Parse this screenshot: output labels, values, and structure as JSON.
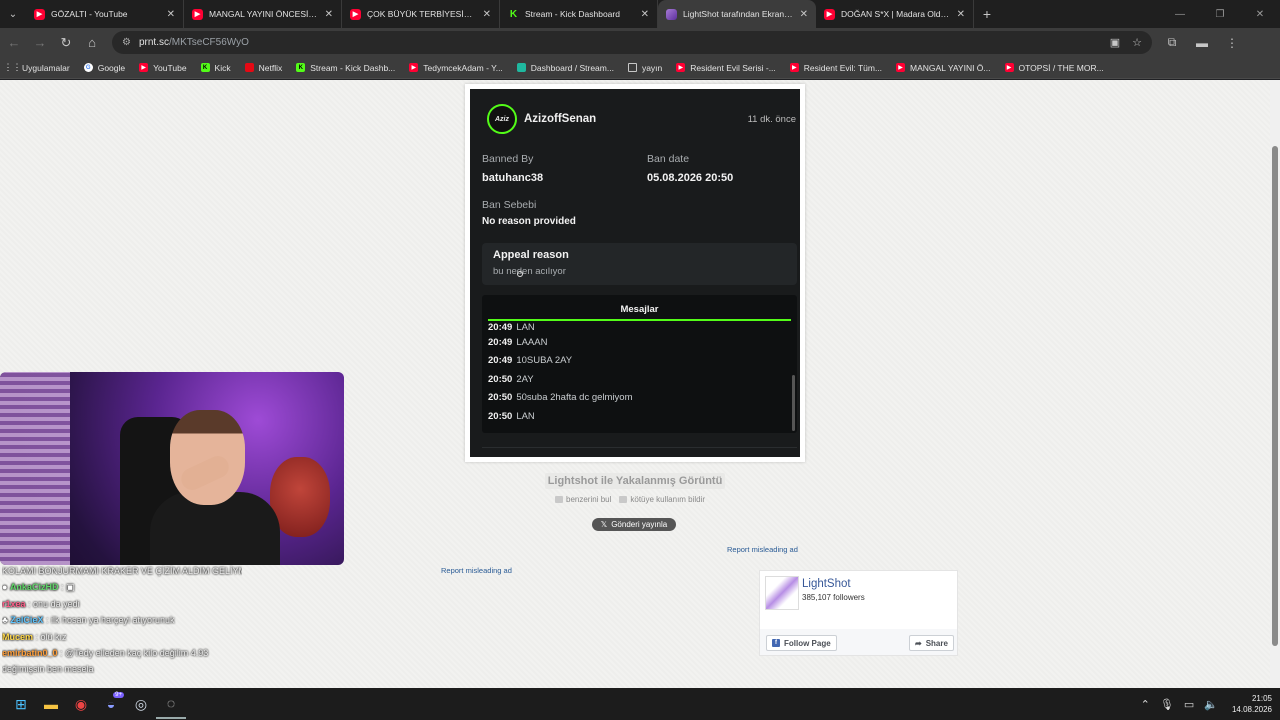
{
  "tabs": [
    {
      "label": "GÖZALTI - YouTube",
      "icon": "youtube-icon"
    },
    {
      "label": "MANGAL YAYINI ÖNCESİ MEKİ",
      "icon": "youtube-icon"
    },
    {
      "label": "ÇOK BÜYÜK TERBİYESİZLİK BEN",
      "icon": "youtube-icon"
    },
    {
      "label": "Stream - Kick Dashboard",
      "icon": "kick-icon"
    },
    {
      "label": "LightShot tarafından Ekran Gör",
      "icon": "lightshot-icon",
      "active": true
    },
    {
      "label": "DOĞAN S*X | Madara Olduk #",
      "icon": "youtube-icon"
    }
  ],
  "address": {
    "host": "prnt.sc",
    "path": "/MKTseCF56WyO"
  },
  "bookmarks": [
    {
      "label": "Uygulamalar",
      "icon": "grid"
    },
    {
      "label": "Google",
      "icon": "g"
    },
    {
      "label": "YouTube",
      "icon": "yt"
    },
    {
      "label": "Kick",
      "icon": "kick"
    },
    {
      "label": "Netflix",
      "icon": "nf"
    },
    {
      "label": "Stream - Kick Dashb...",
      "icon": "kick"
    },
    {
      "label": "TedymcekAdam - Y...",
      "icon": "yt"
    },
    {
      "label": "Dashboard / Stream...",
      "icon": "dash"
    },
    {
      "label": "yayın",
      "icon": "folder"
    },
    {
      "label": "Resident Evil Serisi -...",
      "icon": "yt"
    },
    {
      "label": "Resident Evil: Tüm...",
      "icon": "yt"
    },
    {
      "label": "MANGAL YAYINI Ö...",
      "icon": "yt"
    },
    {
      "label": "OTOPSİ / THE MOR...",
      "icon": "yt"
    }
  ],
  "screenshot": {
    "avatar_text": "Aziz",
    "username": "AzizoffSenan",
    "time_ago": "11 dk. önce",
    "banned_by_label": "Banned By",
    "banned_by": "batuhanc38",
    "ban_date_label": "Ban date",
    "ban_date": "05.08.2026 20:50",
    "reason_label": "Ban Sebebi",
    "reason": "No reason provided",
    "appeal_title": "Appeal reason",
    "appeal_text": "bu neden acılıyor",
    "messages_tab": "Mesajlar",
    "messages": [
      {
        "time": "20:49",
        "text": "LAN"
      },
      {
        "time": "20:49",
        "text": "LAAAN"
      },
      {
        "time": "20:49",
        "text": "10SUBA 2AY"
      },
      {
        "time": "20:50",
        "text": "2AY"
      },
      {
        "time": "20:50",
        "text": "50suba 2hafta dc gelmiyom"
      },
      {
        "time": "20:50",
        "text": "LAN"
      }
    ]
  },
  "lightshot": {
    "caption": "Lightshot ile Yakalanmış Görüntü",
    "find_similar": "benzerini bul",
    "report_abuse": "kötüye kullanım bildir",
    "tweet": "Gönderi yayınla",
    "report_ad": "Report misleading ad"
  },
  "fb": {
    "name": "LightShot",
    "followers": "385,107 followers",
    "follow": "Follow Page",
    "share": "Share"
  },
  "chat": [
    {
      "user": "",
      "color": "#dddddd",
      "msg": "KOLAMI BONJURMAMI KRAKER VE ÇİZİM ALDIM GELİYM"
    },
    {
      "user": "AnkaCizHD",
      "color": "#61d86a",
      "msg": ""
    },
    {
      "user": "r1xea",
      "color": "#ff5f8a",
      "msg": "onu da yedi"
    },
    {
      "user": "ZelCieX",
      "color": "#5ec5ff",
      "msg": "ilk hosan ya harçeyi atıyorunuk"
    },
    {
      "user": "Mucem",
      "color": "#ffd84a",
      "msg": "ölü kız"
    },
    {
      "user": "emirbatin0_0",
      "color": "#ff9f3a",
      "msg": "@Tedy elleden kaç kilo değilim 4.93"
    },
    {
      "user": "",
      "color": "#dddddd",
      "msg": "değimişsin ben mesela"
    }
  ],
  "clock": {
    "time": "21:05",
    "date": "14.08.2026"
  }
}
